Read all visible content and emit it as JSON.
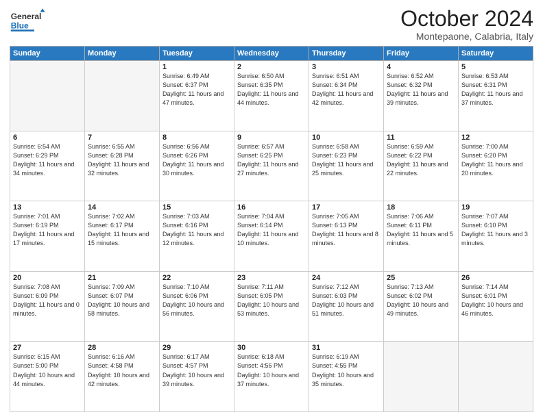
{
  "header": {
    "logo_general": "General",
    "logo_blue": "Blue",
    "month_title": "October 2024",
    "subtitle": "Montepaone, Calabria, Italy"
  },
  "days_of_week": [
    "Sunday",
    "Monday",
    "Tuesday",
    "Wednesday",
    "Thursday",
    "Friday",
    "Saturday"
  ],
  "weeks": [
    [
      {
        "day": "",
        "info": ""
      },
      {
        "day": "",
        "info": ""
      },
      {
        "day": "1",
        "info": "Sunrise: 6:49 AM\nSunset: 6:37 PM\nDaylight: 11 hours and 47 minutes."
      },
      {
        "day": "2",
        "info": "Sunrise: 6:50 AM\nSunset: 6:35 PM\nDaylight: 11 hours and 44 minutes."
      },
      {
        "day": "3",
        "info": "Sunrise: 6:51 AM\nSunset: 6:34 PM\nDaylight: 11 hours and 42 minutes."
      },
      {
        "day": "4",
        "info": "Sunrise: 6:52 AM\nSunset: 6:32 PM\nDaylight: 11 hours and 39 minutes."
      },
      {
        "day": "5",
        "info": "Sunrise: 6:53 AM\nSunset: 6:31 PM\nDaylight: 11 hours and 37 minutes."
      }
    ],
    [
      {
        "day": "6",
        "info": "Sunrise: 6:54 AM\nSunset: 6:29 PM\nDaylight: 11 hours and 34 minutes."
      },
      {
        "day": "7",
        "info": "Sunrise: 6:55 AM\nSunset: 6:28 PM\nDaylight: 11 hours and 32 minutes."
      },
      {
        "day": "8",
        "info": "Sunrise: 6:56 AM\nSunset: 6:26 PM\nDaylight: 11 hours and 30 minutes."
      },
      {
        "day": "9",
        "info": "Sunrise: 6:57 AM\nSunset: 6:25 PM\nDaylight: 11 hours and 27 minutes."
      },
      {
        "day": "10",
        "info": "Sunrise: 6:58 AM\nSunset: 6:23 PM\nDaylight: 11 hours and 25 minutes."
      },
      {
        "day": "11",
        "info": "Sunrise: 6:59 AM\nSunset: 6:22 PM\nDaylight: 11 hours and 22 minutes."
      },
      {
        "day": "12",
        "info": "Sunrise: 7:00 AM\nSunset: 6:20 PM\nDaylight: 11 hours and 20 minutes."
      }
    ],
    [
      {
        "day": "13",
        "info": "Sunrise: 7:01 AM\nSunset: 6:19 PM\nDaylight: 11 hours and 17 minutes."
      },
      {
        "day": "14",
        "info": "Sunrise: 7:02 AM\nSunset: 6:17 PM\nDaylight: 11 hours and 15 minutes."
      },
      {
        "day": "15",
        "info": "Sunrise: 7:03 AM\nSunset: 6:16 PM\nDaylight: 11 hours and 12 minutes."
      },
      {
        "day": "16",
        "info": "Sunrise: 7:04 AM\nSunset: 6:14 PM\nDaylight: 11 hours and 10 minutes."
      },
      {
        "day": "17",
        "info": "Sunrise: 7:05 AM\nSunset: 6:13 PM\nDaylight: 11 hours and 8 minutes."
      },
      {
        "day": "18",
        "info": "Sunrise: 7:06 AM\nSunset: 6:11 PM\nDaylight: 11 hours and 5 minutes."
      },
      {
        "day": "19",
        "info": "Sunrise: 7:07 AM\nSunset: 6:10 PM\nDaylight: 11 hours and 3 minutes."
      }
    ],
    [
      {
        "day": "20",
        "info": "Sunrise: 7:08 AM\nSunset: 6:09 PM\nDaylight: 11 hours and 0 minutes."
      },
      {
        "day": "21",
        "info": "Sunrise: 7:09 AM\nSunset: 6:07 PM\nDaylight: 10 hours and 58 minutes."
      },
      {
        "day": "22",
        "info": "Sunrise: 7:10 AM\nSunset: 6:06 PM\nDaylight: 10 hours and 56 minutes."
      },
      {
        "day": "23",
        "info": "Sunrise: 7:11 AM\nSunset: 6:05 PM\nDaylight: 10 hours and 53 minutes."
      },
      {
        "day": "24",
        "info": "Sunrise: 7:12 AM\nSunset: 6:03 PM\nDaylight: 10 hours and 51 minutes."
      },
      {
        "day": "25",
        "info": "Sunrise: 7:13 AM\nSunset: 6:02 PM\nDaylight: 10 hours and 49 minutes."
      },
      {
        "day": "26",
        "info": "Sunrise: 7:14 AM\nSunset: 6:01 PM\nDaylight: 10 hours and 46 minutes."
      }
    ],
    [
      {
        "day": "27",
        "info": "Sunrise: 6:15 AM\nSunset: 5:00 PM\nDaylight: 10 hours and 44 minutes."
      },
      {
        "day": "28",
        "info": "Sunrise: 6:16 AM\nSunset: 4:58 PM\nDaylight: 10 hours and 42 minutes."
      },
      {
        "day": "29",
        "info": "Sunrise: 6:17 AM\nSunset: 4:57 PM\nDaylight: 10 hours and 39 minutes."
      },
      {
        "day": "30",
        "info": "Sunrise: 6:18 AM\nSunset: 4:56 PM\nDaylight: 10 hours and 37 minutes."
      },
      {
        "day": "31",
        "info": "Sunrise: 6:19 AM\nSunset: 4:55 PM\nDaylight: 10 hours and 35 minutes."
      },
      {
        "day": "",
        "info": ""
      },
      {
        "day": "",
        "info": ""
      }
    ]
  ]
}
